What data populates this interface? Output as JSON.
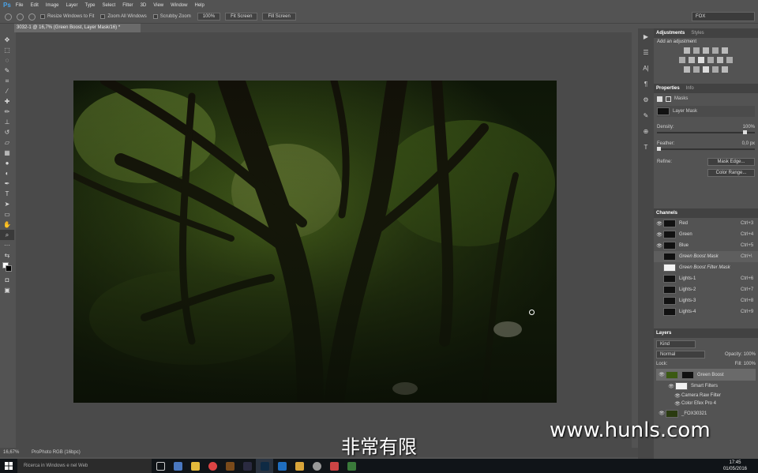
{
  "menubar": {
    "app_logo": "Ps",
    "items": [
      "File",
      "Edit",
      "Image",
      "Layer",
      "Type",
      "Select",
      "Filter",
      "3D",
      "View",
      "Window",
      "Help"
    ]
  },
  "options": {
    "resize_windows": "Resize Windows to Fit",
    "zoom_all": "Zoom All Windows",
    "scrubby": "Scrubby Zoom",
    "zoom_100": "100%",
    "fit_screen": "Fit Screen",
    "fill_screen": "Fill Screen",
    "workspace": "FOX"
  },
  "document": {
    "tab_title": "3032-1 @ 16,7% (Green Boost, Layer Mask/16) *"
  },
  "status": {
    "zoom": "16,67%",
    "profile": "ProPhoto RGB (16bpc)"
  },
  "adjustments": {
    "tab_active": "Adjustments",
    "tab_inactive": "Styles",
    "subtitle": "Add an adjustment"
  },
  "properties": {
    "tab_active": "Properties",
    "tab_inactive": "Info",
    "masks_label": "Masks",
    "layer_mask_label": "Layer Mask",
    "density_label": "Density:",
    "density_value": "100%",
    "feather_label": "Feather:",
    "feather_value": "0,0 px",
    "refine_label": "Refine:",
    "mask_edge_btn": "Mask Edge...",
    "color_range_btn": "Color Range...",
    "density_fraction": 1.0,
    "feather_fraction": 0.0
  },
  "channels": {
    "title": "Channels",
    "rows": [
      {
        "name": "Red",
        "shortcut": "Ctrl+3",
        "visible": true,
        "white": false
      },
      {
        "name": "Green",
        "shortcut": "Ctrl+4",
        "visible": true,
        "white": false
      },
      {
        "name": "Blue",
        "shortcut": "Ctrl+5",
        "visible": true,
        "white": false
      },
      {
        "name": "Green Boost Mask",
        "shortcut": "Ctrl+\\",
        "visible": false,
        "white": false
      },
      {
        "name": "Green Boost Filter Mask",
        "shortcut": "",
        "visible": false,
        "white": true
      },
      {
        "name": "Lights-1",
        "shortcut": "Ctrl+6",
        "visible": false,
        "white": false
      },
      {
        "name": "Lights-2",
        "shortcut": "Ctrl+7",
        "visible": false,
        "white": false
      },
      {
        "name": "Lights-3",
        "shortcut": "Ctrl+8",
        "visible": false,
        "white": false
      },
      {
        "name": "Lights-4",
        "shortcut": "Ctrl+9",
        "visible": false,
        "white": false
      }
    ]
  },
  "layers": {
    "title": "Layers",
    "kind_filter": "Kind",
    "blend_mode": "Normal",
    "opacity_label": "Opacity:",
    "opacity_value": "100%",
    "lock_label": "Lock:",
    "fill_label": "Fill:",
    "fill_value": "100%",
    "items": {
      "green_boost": "Green Boost",
      "smart_filters": "Smart Filters",
      "camera_raw": "Camera Raw Filter",
      "color_efex": "Color Efex Pro 4",
      "base_layer": "_FOX30321"
    }
  },
  "taskbar": {
    "search_placeholder": "Ricerca in Windows e nel Web",
    "time": "17:45",
    "date": "01/05/2016"
  },
  "overlay": {
    "subtitle": "非常有限",
    "watermark": "www.hunls.com"
  },
  "colors": {
    "ps_blue": "#4aa3e8",
    "panel_bg": "#535353",
    "canvas_bg": "#4a4a4a",
    "taskbar_bg": "#101418"
  }
}
